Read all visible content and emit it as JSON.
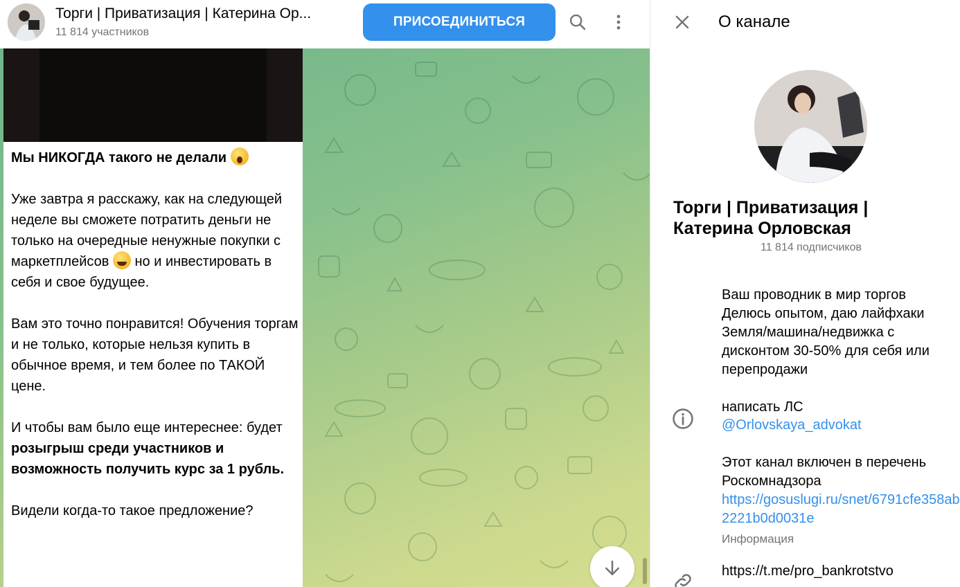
{
  "colors": {
    "accent": "#3390ec",
    "secondary_text": "#707579",
    "chat_bg_top": "#6fb58a",
    "chat_bg_bottom": "#d6dd8f"
  },
  "header": {
    "title": "Торги | Приватизация | Катерина Ор...",
    "subtitle": "11 814 участников",
    "join_label": "ПРИСОЕДИНИТЬСЯ",
    "icons": [
      "search-icon",
      "more-vertical-icon"
    ]
  },
  "message": {
    "line_title": "Мы НИКОГДА такого не делали",
    "p1_a": "Уже завтра я расскажу, как на следующей неделе вы сможете потратить деньги не только на очередные ненужные покупки с маркетплейсов",
    "p1_b": "но и инвестировать в себя и свое будущее.",
    "p2": "Вам это точно понравится! Обучения торгам и не только, которые нельзя купить в обычное время, и тем более по ТАКОЙ цене.",
    "p3_a": "И чтобы вам было еще интереснее: будет",
    "p3_bold": "розыгрыш среди участников и возможность получить курс за 1 рубль.",
    "p4": "Видели когда-то такое предложение?",
    "emojis": [
      "face-screaming-emoji",
      "grinning-sweat-emoji"
    ]
  },
  "info_panel": {
    "title": "О канале",
    "channel_name": "Торги | Приватизация | Катерина Орловская",
    "subscribers": "11 814 подписчиков",
    "description": "Ваш проводник в мир торгов Делюсь опытом, даю лайфхаки Земля/машина/недвижка с дисконтом 30-50% для себя или перепродажи",
    "contact_label": "написать ЛС",
    "contact_link": "@Orlovskaya_advokat",
    "rkn_text": "Этот канал включен в перечень Роскомнадзора",
    "rkn_link": "https://gosuslugi.ru/snet/6791cfe358ab2221b0d0031e",
    "rkn_caption": "Информация",
    "tme_link": "https://t.me/pro_bankrotstvo",
    "icons": [
      "close-icon",
      "info-icon",
      "link-icon"
    ]
  }
}
